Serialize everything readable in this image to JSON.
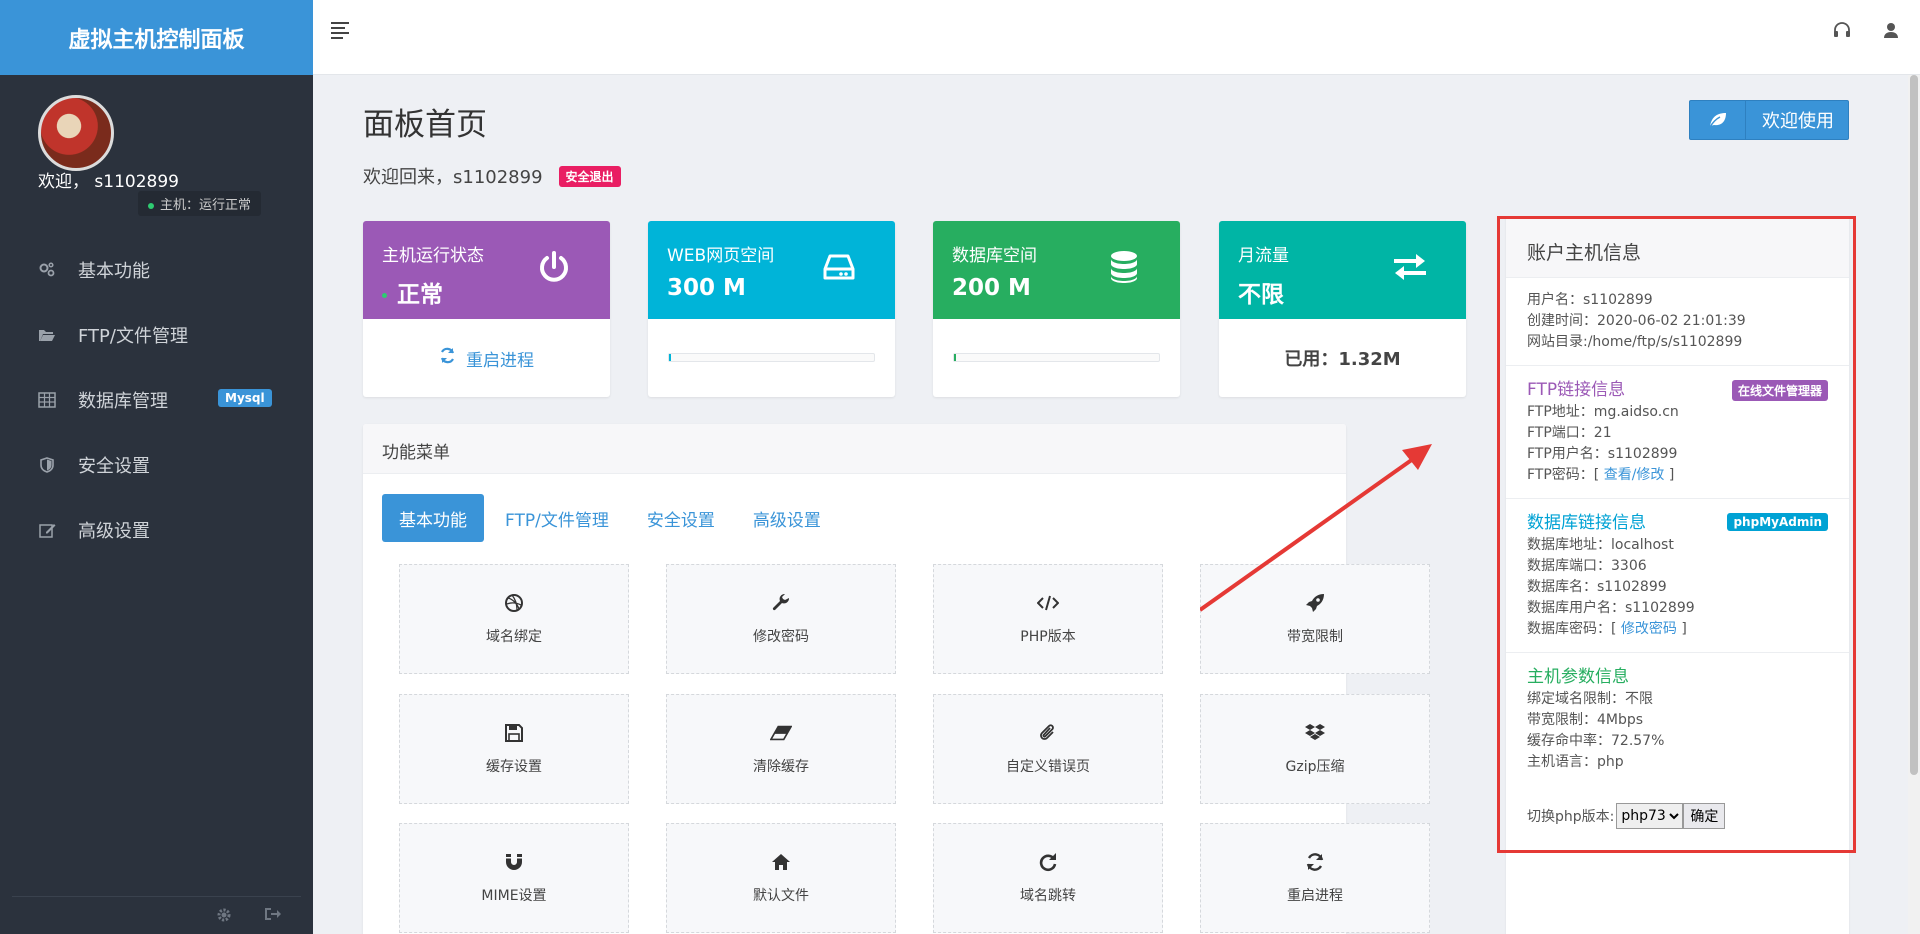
{
  "sidebar": {
    "brand": "虚拟主机控制面板",
    "welcome": "欢迎，  s1102899",
    "host_status": "主机：运行正常",
    "items": [
      {
        "label": "基本功能",
        "icon": "gears-icon"
      },
      {
        "label": "FTP/文件管理",
        "icon": "folder-open-icon"
      },
      {
        "label": "数据库管理",
        "icon": "table-icon",
        "badge": "Mysql"
      },
      {
        "label": "安全设置",
        "icon": "shield-icon"
      },
      {
        "label": "高级设置",
        "icon": "edit-icon"
      }
    ]
  },
  "page": {
    "title": "面板首页",
    "welcome_back": "欢迎回来，s1102899",
    "logout": "安全退出",
    "welcome_button": "欢迎使用"
  },
  "stats": [
    {
      "label": "主机运行状态",
      "value": "正常",
      "color": "#9b59b6",
      "icon": "power-icon",
      "action": "重启进程"
    },
    {
      "label": "WEB网页空间",
      "value": "300 M",
      "color": "#00b4d8",
      "icon": "hdd-icon",
      "progress": 0.01
    },
    {
      "label": "数据库空间",
      "value": "200 M",
      "color": "#27ae60",
      "icon": "database-icon",
      "progress": 0.01
    },
    {
      "label": "月流量",
      "value": "不限",
      "color": "#00b5a5",
      "icon": "exchange-icon",
      "used": "已用：1.32M"
    }
  ],
  "menu": {
    "title": "功能菜单",
    "tabs": [
      "基本功能",
      "FTP/文件管理",
      "安全设置",
      "高级设置"
    ],
    "tiles": [
      {
        "label": "域名绑定",
        "icon": "dribbble-icon"
      },
      {
        "label": "修改密码",
        "icon": "wrench-icon"
      },
      {
        "label": "PHP版本",
        "icon": "code-icon"
      },
      {
        "label": "带宽限制",
        "icon": "rocket-icon"
      },
      {
        "label": "缓存设置",
        "icon": "save-icon"
      },
      {
        "label": "清除缓存",
        "icon": "eraser-icon"
      },
      {
        "label": "自定义错误页",
        "icon": "paperclip-icon"
      },
      {
        "label": "Gzip压缩",
        "icon": "dropbox-icon"
      },
      {
        "label": "MIME设置",
        "icon": "magnet-icon"
      },
      {
        "label": "默认文件",
        "icon": "home-icon"
      },
      {
        "label": "域名跳转",
        "icon": "redo-icon"
      },
      {
        "label": "重启进程",
        "icon": "refresh-icon"
      }
    ]
  },
  "account": {
    "title": "账户主机信息",
    "basic": [
      "用户名：s1102899",
      "创建时间：2020-06-02 21:01:39",
      "网站目录:/home/ftp/s/s1102899"
    ],
    "ftp": {
      "title": "FTP链接信息",
      "badge": "在线文件管理器",
      "lines": [
        "FTP地址：mg.aidso.cn",
        "FTP端口：21",
        "FTP用户名：s1102899"
      ],
      "pwd_prefix": "FTP密码：[ ",
      "pwd_link": "查看/修改",
      "pwd_suffix": " ]"
    },
    "db": {
      "title": "数据库链接信息",
      "badge": "phpMyAdmin",
      "lines": [
        "数据库地址：localhost",
        "数据库端口：3306",
        "数据库名：s1102899",
        "数据库用户名：s1102899"
      ],
      "pwd_prefix": "数据库密码：[ ",
      "pwd_link": "修改密码",
      "pwd_suffix": " ]"
    },
    "host": {
      "title": "主机参数信息",
      "lines": [
        "绑定域名限制：不限",
        "带宽限制：4Mbps",
        "缓存命中率：72.57%",
        "主机语言：php"
      ]
    },
    "php_switch": {
      "label": "切换php版本:",
      "selected": "php73",
      "confirm": "确定"
    }
  },
  "colors": {
    "accent": "#3a94d8",
    "ftp_title": "#9b59b6",
    "db_title": "#00a2d4",
    "host_title": "#27ae60",
    "annotation": "#e53935"
  }
}
